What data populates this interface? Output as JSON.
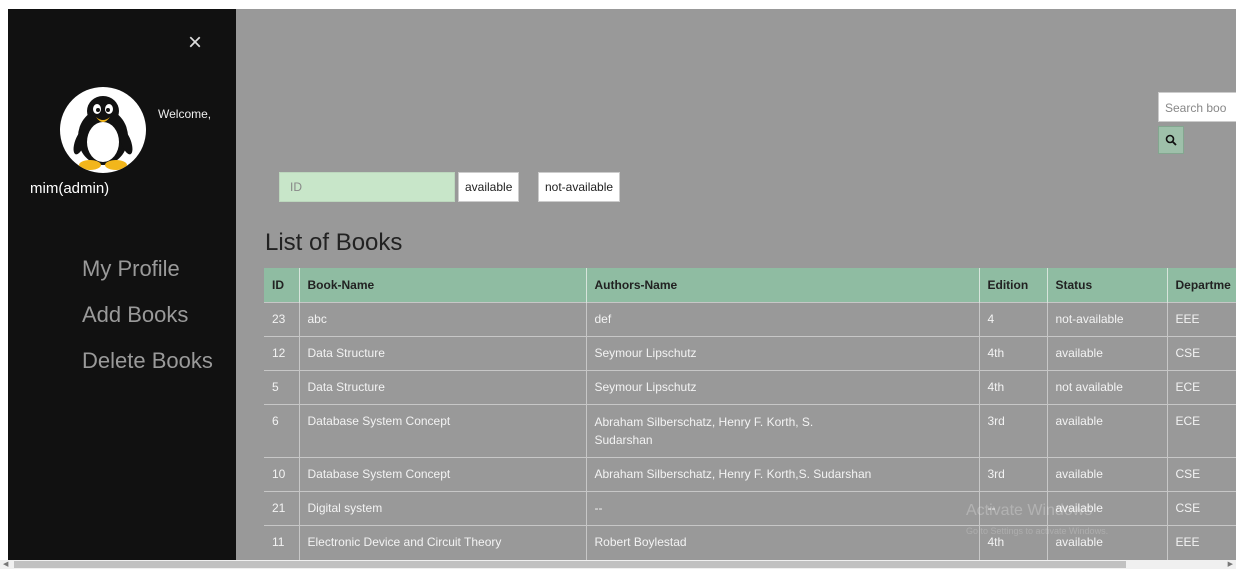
{
  "sidebar": {
    "close_symbol": "×",
    "welcome": "Welcome,",
    "username": "mim(admin)",
    "nav": [
      "My Profile",
      "Add Books",
      "Delete Books"
    ]
  },
  "search": {
    "placeholder": "Search boo",
    "icon": "search-icon"
  },
  "filter": {
    "id_placeholder": "ID",
    "available_label": "available",
    "not_available_label": "not-available"
  },
  "list": {
    "title": "List of Books",
    "headers": [
      "ID",
      "Book-Name",
      "Authors-Name",
      "Edition",
      "Status",
      "Departme"
    ],
    "rows": [
      [
        "23",
        "abc",
        "def",
        "4",
        "not-available",
        "EEE"
      ],
      [
        "12",
        "Data Structure",
        "Seymour Lipschutz",
        "4th",
        "available",
        "CSE"
      ],
      [
        "5",
        "Data Structure",
        "Seymour Lipschutz",
        "4th",
        "not available",
        "ECE"
      ],
      [
        "6",
        "Database System Concept",
        "Abraham Silberschatz, Henry F. Korth, S. Sudarshan",
        "3rd",
        "available",
        "ECE"
      ],
      [
        "10",
        "Database System Concept",
        "Abraham Silberschatz, Henry F. Korth,S. Sudarshan",
        "3rd",
        "available",
        "CSE"
      ],
      [
        "21",
        "Digital system",
        "--",
        "--",
        "available",
        "CSE"
      ],
      [
        "11",
        "Electronic Device and Circuit Theory",
        "Robert Boylestad",
        "4th",
        "available",
        "EEE"
      ]
    ]
  },
  "watermark": {
    "line1": "Activate Windows",
    "line2": "Go to Settings to activate Windows."
  },
  "colors": {
    "sidebar_bg": "#111111",
    "main_bg": "#999999",
    "header_bg": "#8fbca2",
    "id_input_bg": "#c8e6c9"
  }
}
